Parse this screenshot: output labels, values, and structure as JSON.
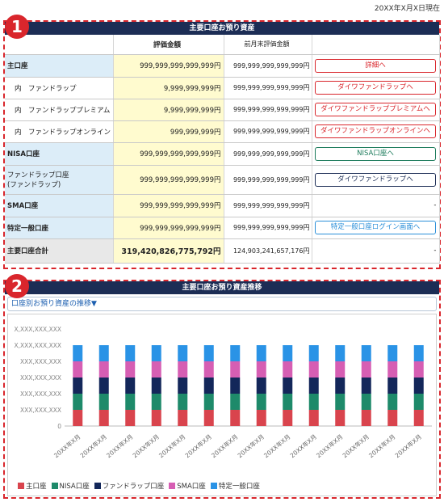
{
  "date_note": "20XX年X月X日現在",
  "badges": [
    "1",
    "2"
  ],
  "section1": {
    "title": "主要口座お預り資産",
    "headers": {
      "name": "",
      "value": "評価金額",
      "prev": "前月末評価金額",
      "action": ""
    },
    "rows": [
      {
        "name": "主口座",
        "value": "999,999,999,999,999円",
        "prev": "999,999,999,999,999円",
        "button": "詳細へ",
        "style": "red",
        "sub": false,
        "bold": true
      },
      {
        "name": "内　ファンドラップ",
        "value": "9,999,999,999円",
        "prev": "999,999,999,999,999円",
        "button": "ダイワファンドラップへ",
        "style": "red",
        "sub": true,
        "bold": false
      },
      {
        "name": "内　ファンドラッププレミアム",
        "value": "9,999,999,999円",
        "prev": "999,999,999,999,999円",
        "button": "ダイワファンドラッププレミアムへ",
        "style": "red",
        "sub": true,
        "bold": false
      },
      {
        "name": "内　ファンドラップオンライン",
        "value": "999,999,999円",
        "prev": "999,999,999,999,999円",
        "button": "ダイワファンドラップオンラインへ",
        "style": "red",
        "sub": true,
        "bold": false
      },
      {
        "name": "NISA口座",
        "value": "999,999,999,999,999円",
        "prev": "999,999,999,999,999円",
        "button": "NISA口座へ",
        "style": "green",
        "sub": false,
        "bold": true
      },
      {
        "name": "ファンドラップ口座",
        "name2": "(ファンドラップ)",
        "value": "999,999,999,999,999円",
        "prev": "999,999,999,999,999円",
        "button": "ダイワファンドラップへ",
        "style": "navy",
        "sub": false,
        "bold": false
      },
      {
        "name": "SMA口座",
        "value": "999,999,999,999,999円",
        "prev": "999,999,999,999,999円",
        "button": "",
        "dash": "-",
        "style": "",
        "sub": false,
        "bold": true
      },
      {
        "name": "特定一般口座",
        "value": "999,999,999,999,999円",
        "prev": "999,999,999,999,999円",
        "button": "特定一般口座ログイン画面へ",
        "style": "blue",
        "sub": false,
        "bold": true
      }
    ],
    "total": {
      "name": "主要口座合計",
      "value": "319,420,826,775,792円",
      "prev": "124,903,241,657,176円",
      "dash": "-"
    }
  },
  "section2": {
    "title": "主要口座お預り資産推移",
    "dropdown_label": "口座別お預り資産の推移▼"
  },
  "chart_data": {
    "type": "bar",
    "stacked": true,
    "categories": [
      "20XX年X月",
      "20XX年X月",
      "20XX年X月",
      "20XX年X月",
      "20XX年X月",
      "20XX年X月",
      "20XX年X月",
      "20XX年X月",
      "20XX年X月",
      "20XX年X月",
      "20XX年X月",
      "20XX年X月",
      "20XX年X月",
      "20XX年X月"
    ],
    "yticks": [
      "0",
      "XXX,XXX,XXX",
      "XXX,XXX,XXX",
      "XXX,XXX,XXX",
      "XXX,XXX,XXX",
      "X,XXX,XXX,XXX",
      "X,XXX,XXX,XXX"
    ],
    "ylim": [
      0,
      6
    ],
    "series": [
      {
        "name": "主口座",
        "color": "#d9444d",
        "values": [
          1,
          1,
          1,
          1,
          1,
          1,
          1,
          1,
          1,
          1,
          1,
          1,
          1,
          1
        ]
      },
      {
        "name": "NISA口座",
        "color": "#1e8a6a",
        "values": [
          1,
          1,
          1,
          1,
          1,
          1,
          1,
          1,
          1,
          1,
          1,
          1,
          1,
          1
        ]
      },
      {
        "name": "ファンドラップ口座",
        "color": "#13275a",
        "values": [
          1,
          1,
          1,
          1,
          1,
          1,
          1,
          1,
          1,
          1,
          1,
          1,
          1,
          1
        ]
      },
      {
        "name": "SMA口座",
        "color": "#d65eb3",
        "values": [
          1,
          1,
          1,
          1,
          1,
          1,
          1,
          1,
          1,
          1,
          1,
          1,
          1,
          1
        ]
      },
      {
        "name": "特定一般口座",
        "color": "#2a93e6",
        "values": [
          1,
          1,
          1,
          1,
          1,
          1,
          1,
          1,
          1,
          1,
          1,
          1,
          1,
          1
        ]
      }
    ],
    "legend": "bottom-left",
    "grid": false
  }
}
